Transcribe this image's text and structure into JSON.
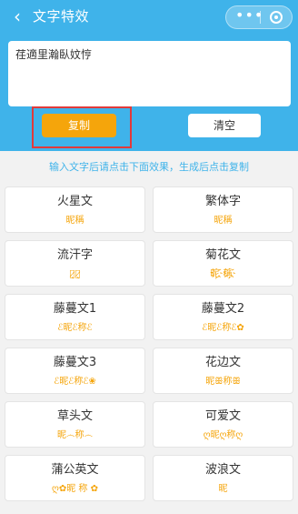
{
  "header": {
    "title": "文字特效",
    "back_icon": "‹",
    "more_icon": "•••"
  },
  "input": {
    "value": "荏適里瀚臥妏悙"
  },
  "buttons": {
    "copy_label": "复制",
    "clear_label": "清空"
  },
  "hint": "输入文字后请点击下面效果，生成后点击复制",
  "effects": [
    {
      "name": "火星文",
      "preview": "昵稱"
    },
    {
      "name": "繁体字",
      "preview": "昵稱"
    },
    {
      "name": "流汗字",
      "preview": "昵̷̨稱̷̨"
    },
    {
      "name": "菊花文",
      "preview": "昵҉稱҉"
    },
    {
      "name": "藤蔓文1",
      "preview": "ℰ昵ℰ称ℰ"
    },
    {
      "name": "藤蔓文2",
      "preview": "ℰ昵ℰ称ℰ✿"
    },
    {
      "name": "藤蔓文3",
      "preview": "ℰ昵ℰ称ℰ❀"
    },
    {
      "name": "花边文",
      "preview": "昵ꕥ称ꕥ"
    },
    {
      "name": "草头文",
      "preview": "昵෴称෴"
    },
    {
      "name": "可爱文",
      "preview": "ღ昵ღ称ღ"
    },
    {
      "name": "蒲公英文",
      "preview": "ღ✿昵 称 ✿"
    },
    {
      "name": "波浪文",
      "preview": "昵"
    }
  ],
  "colors": {
    "header_bg": "#3fb3ea",
    "accent": "#f5a50b",
    "highlight": "#e23a3a"
  }
}
